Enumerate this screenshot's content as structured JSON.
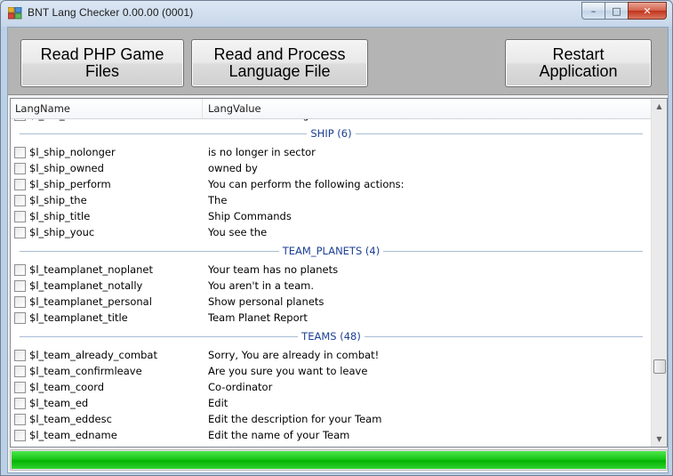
{
  "window": {
    "title": "BNT Lang Checker 0.00.00 (0001)",
    "caption": {
      "minimize": "–",
      "maximize": "□",
      "close": "✕"
    }
  },
  "toolbar": {
    "read_php_label": "Read PHP Game\nFiles",
    "read_process_label": "Read and Process\nLanguage File",
    "restart_label": "Restart\nApplication"
  },
  "list": {
    "columns": [
      "LangName",
      "LangValue"
    ],
    "groups": [
      {
        "title": "",
        "items": [
          {
            "name": "$l_die_what",
            "value": "What was I thinking?"
          }
        ]
      },
      {
        "title": "SHIP (6)",
        "items": [
          {
            "name": "$l_ship_nolonger",
            "value": "is no longer in sector"
          },
          {
            "name": "$l_ship_owned",
            "value": "owned by"
          },
          {
            "name": "$l_ship_perform",
            "value": "You can perform the following actions:"
          },
          {
            "name": "$l_ship_the",
            "value": "The"
          },
          {
            "name": "$l_ship_title",
            "value": "Ship Commands"
          },
          {
            "name": "$l_ship_youc",
            "value": "You see the"
          }
        ]
      },
      {
        "title": "TEAM_PLANETS (4)",
        "items": [
          {
            "name": "$l_teamplanet_noplanet",
            "value": "Your team has no planets"
          },
          {
            "name": "$l_teamplanet_notally",
            "value": "You aren't in a team."
          },
          {
            "name": "$l_teamplanet_personal",
            "value": "Show personal planets"
          },
          {
            "name": "$l_teamplanet_title",
            "value": "Team Planet Report"
          }
        ]
      },
      {
        "title": "TEAMS (48)",
        "items": [
          {
            "name": "$l_team_already_combat",
            "value": "Sorry, You are already in combat!"
          },
          {
            "name": "$l_team_confirmleave",
            "value": "Are you sure you want to leave"
          },
          {
            "name": "$l_team_coord",
            "value": "Co-ordinator"
          },
          {
            "name": "$l_team_ed",
            "value": "Edit"
          },
          {
            "name": "$l_team_eddesc",
            "value": "Edit the description for your Team"
          },
          {
            "name": "$l_team_edname",
            "value": "Edit the name of your Team"
          }
        ]
      }
    ]
  },
  "scroll": {
    "up": "▲",
    "down": "▼",
    "position": 0.8
  },
  "progress": {
    "value": 1.0,
    "color": "#18c718"
  }
}
